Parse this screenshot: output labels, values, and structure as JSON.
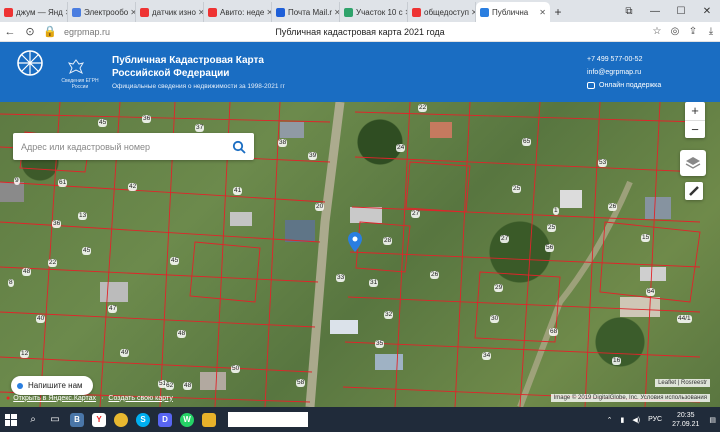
{
  "browser": {
    "tabs": [
      {
        "label": "джум — Янд",
        "color": "#e33"
      },
      {
        "label": "Электрообо",
        "color": "#4a7de0"
      },
      {
        "label": "датчик изно",
        "color": "#e33"
      },
      {
        "label": "Авито: неде",
        "color": "#e33"
      },
      {
        "label": "Почта Mail.r",
        "color": "#1e5fd8"
      },
      {
        "label": "Участок 10 с",
        "color": "#2fa36b"
      },
      {
        "label": "общедоступ",
        "color": "#e33"
      },
      {
        "label": "Публична",
        "color": "#2a7ee0",
        "active": true
      }
    ],
    "url": "egrpmap.ru",
    "page_title": "Публичная кадастровая карта 2021 года"
  },
  "header": {
    "rosreestr_label": "Сведения ЕГРН России",
    "title_line1": "Публичная Кадастровая Карта",
    "title_line2": "Российской Федерации",
    "subtitle": "Официальные сведения о недвижимости за 1998-2021 гг",
    "phone": "+7 499 577-00-52",
    "email": "info@egrpmap.ru",
    "support": "Онлайн поддержка"
  },
  "map": {
    "search_placeholder": "Адрес или кадастровый номер",
    "zoom_in": "+",
    "zoom_out": "−",
    "chat_label": "Напишите нам",
    "yandex_open": "Открыть в Яндекс.Картах",
    "yandex_create": "Создать свою карту",
    "attribution1": "Leaflet | Rosreestr",
    "attribution2": "Image © 2019 DigitalGlobe, Inc. Условия использования",
    "plot_numbers": [
      "36",
      "37",
      "38",
      "39",
      "45",
      "65",
      "22",
      "24",
      "45",
      "42",
      "53",
      "9",
      "13",
      "61",
      "41",
      "27",
      "25",
      "1",
      "29",
      "56",
      "20",
      "28",
      "22",
      "33",
      "31",
      "27",
      "26",
      "45",
      "30",
      "34",
      "35",
      "48",
      "49",
      "47",
      "16",
      "36",
      "45",
      "32",
      "50",
      "51",
      "58",
      "64",
      "68",
      "44/1",
      "40",
      "8",
      "12",
      "43",
      "15",
      "48",
      "48",
      "62",
      "25",
      "26"
    ]
  },
  "taskbar": {
    "lang": "РУС",
    "time": "20:35",
    "date": "27.09.21"
  }
}
